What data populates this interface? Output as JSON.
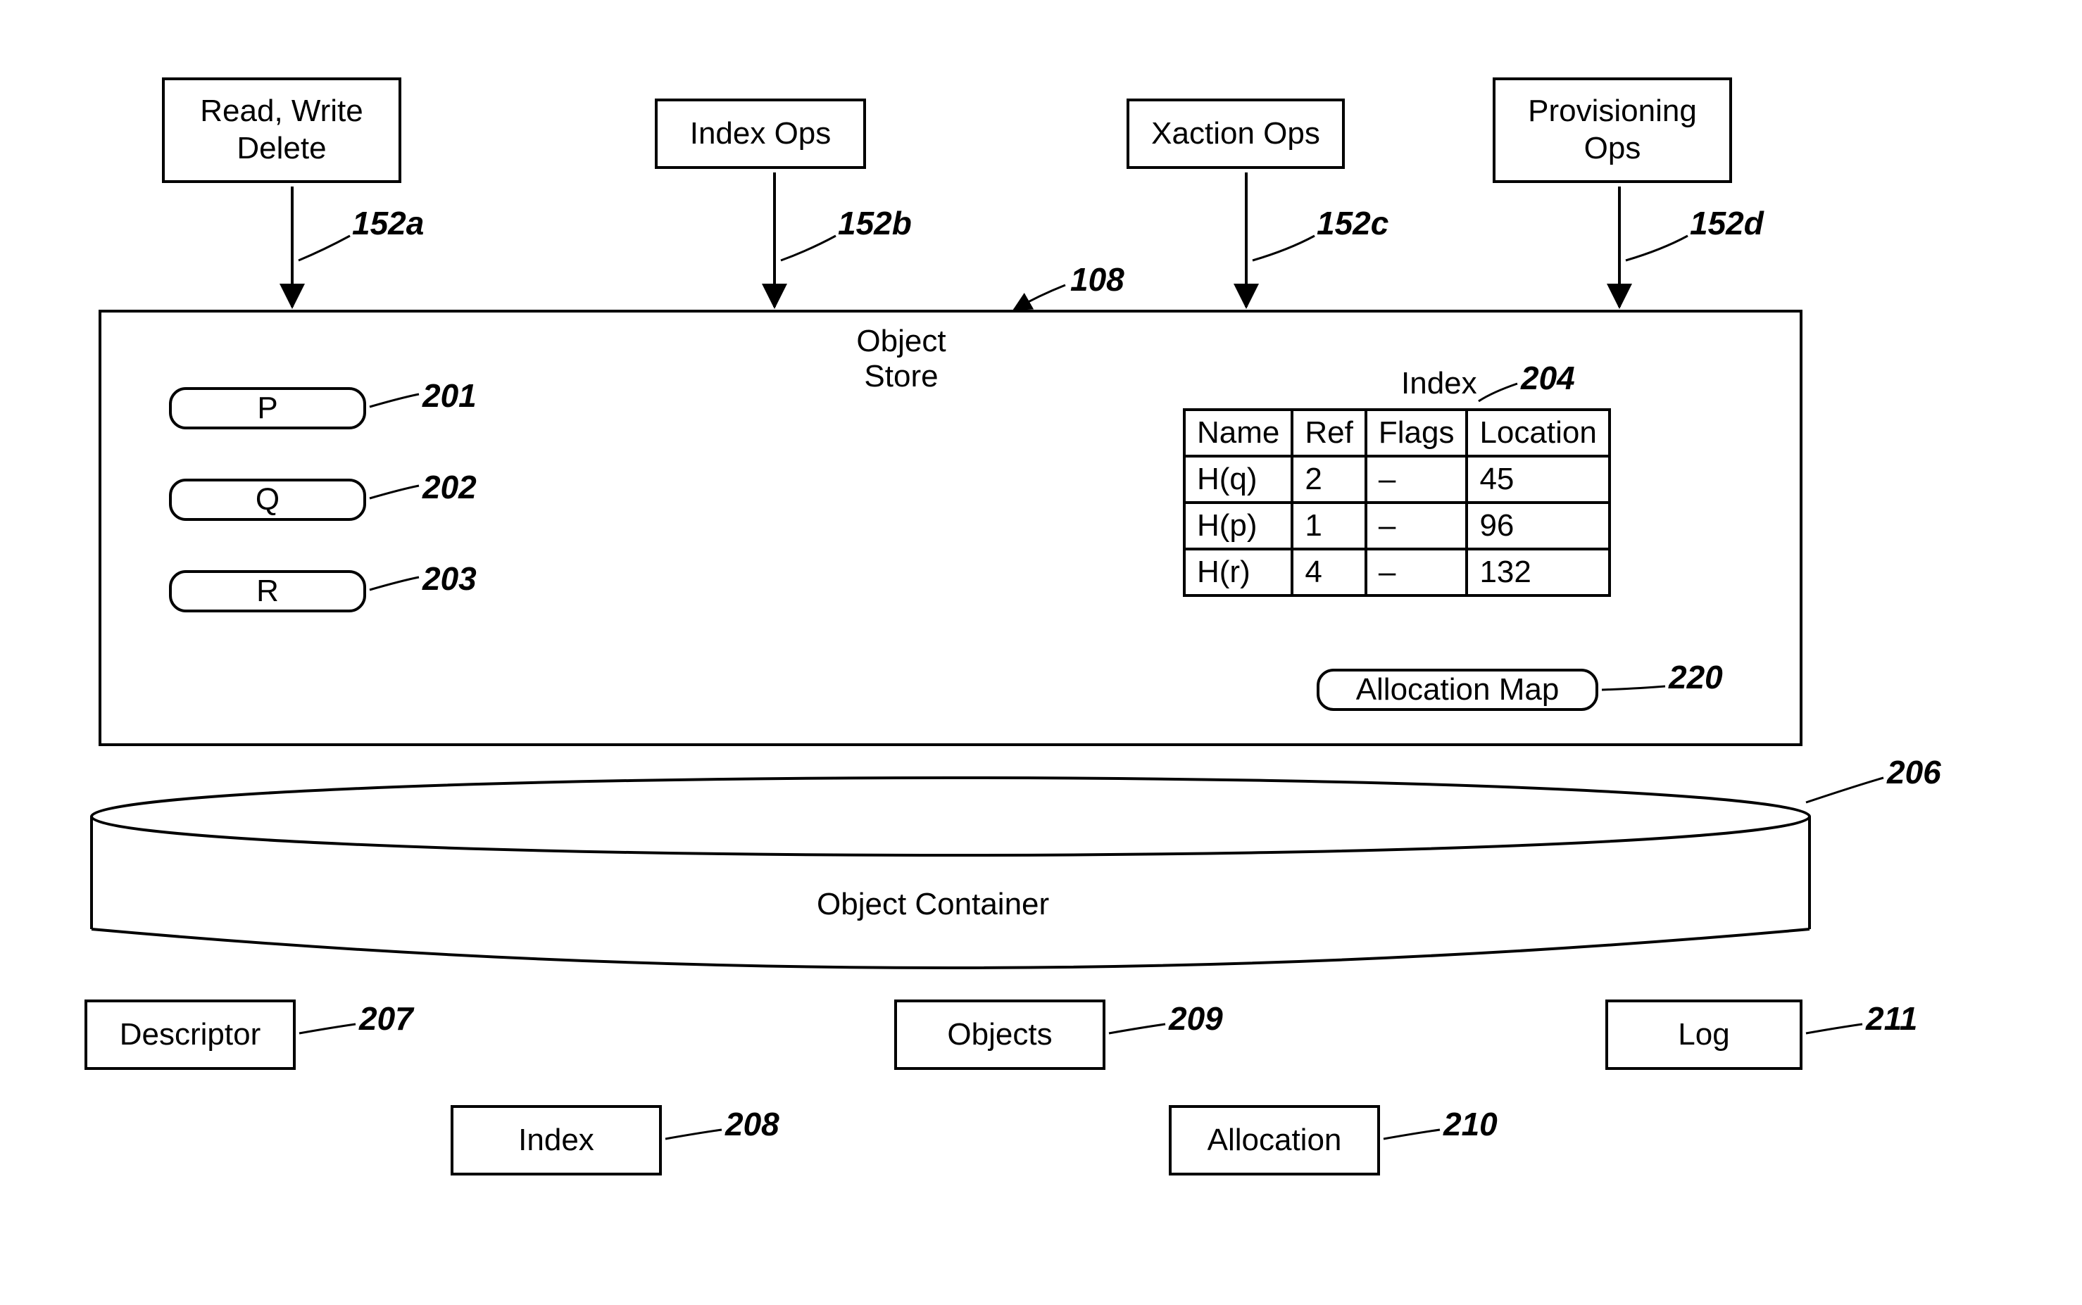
{
  "ops": {
    "a": {
      "line1": "Read, Write",
      "line2": "Delete",
      "ref": "152a"
    },
    "b": {
      "label": "Index Ops",
      "ref": "152b"
    },
    "c": {
      "label": "Xaction Ops",
      "ref": "152c"
    },
    "d": {
      "line1": "Provisioning",
      "line2": "Ops",
      "ref": "152d"
    }
  },
  "store": {
    "title_line1": "Object",
    "title_line2": "Store",
    "ref": "108",
    "objects": {
      "p": {
        "label": "P",
        "ref": "201"
      },
      "q": {
        "label": "Q",
        "ref": "202"
      },
      "r": {
        "label": "R",
        "ref": "203"
      }
    },
    "index": {
      "title": "Index",
      "ref": "204",
      "headers": {
        "name": "Name",
        "ref": "Ref",
        "flags": "Flags",
        "location": "Location"
      },
      "rows": [
        {
          "name": "H(q)",
          "ref": "2",
          "flags": "–",
          "location": "45"
        },
        {
          "name": "H(p)",
          "ref": "1",
          "flags": "–",
          "location": "96"
        },
        {
          "name": "H(r)",
          "ref": "4",
          "flags": "–",
          "location": "132"
        }
      ]
    },
    "alloc_map": {
      "label": "Allocation Map",
      "ref": "220"
    }
  },
  "container": {
    "label": "Object Container",
    "ref": "206",
    "parts": {
      "descriptor": {
        "label": "Descriptor",
        "ref": "207"
      },
      "index": {
        "label": "Index",
        "ref": "208"
      },
      "objects": {
        "label": "Objects",
        "ref": "209"
      },
      "allocation": {
        "label": "Allocation",
        "ref": "210"
      },
      "log": {
        "label": "Log",
        "ref": "211"
      }
    }
  }
}
